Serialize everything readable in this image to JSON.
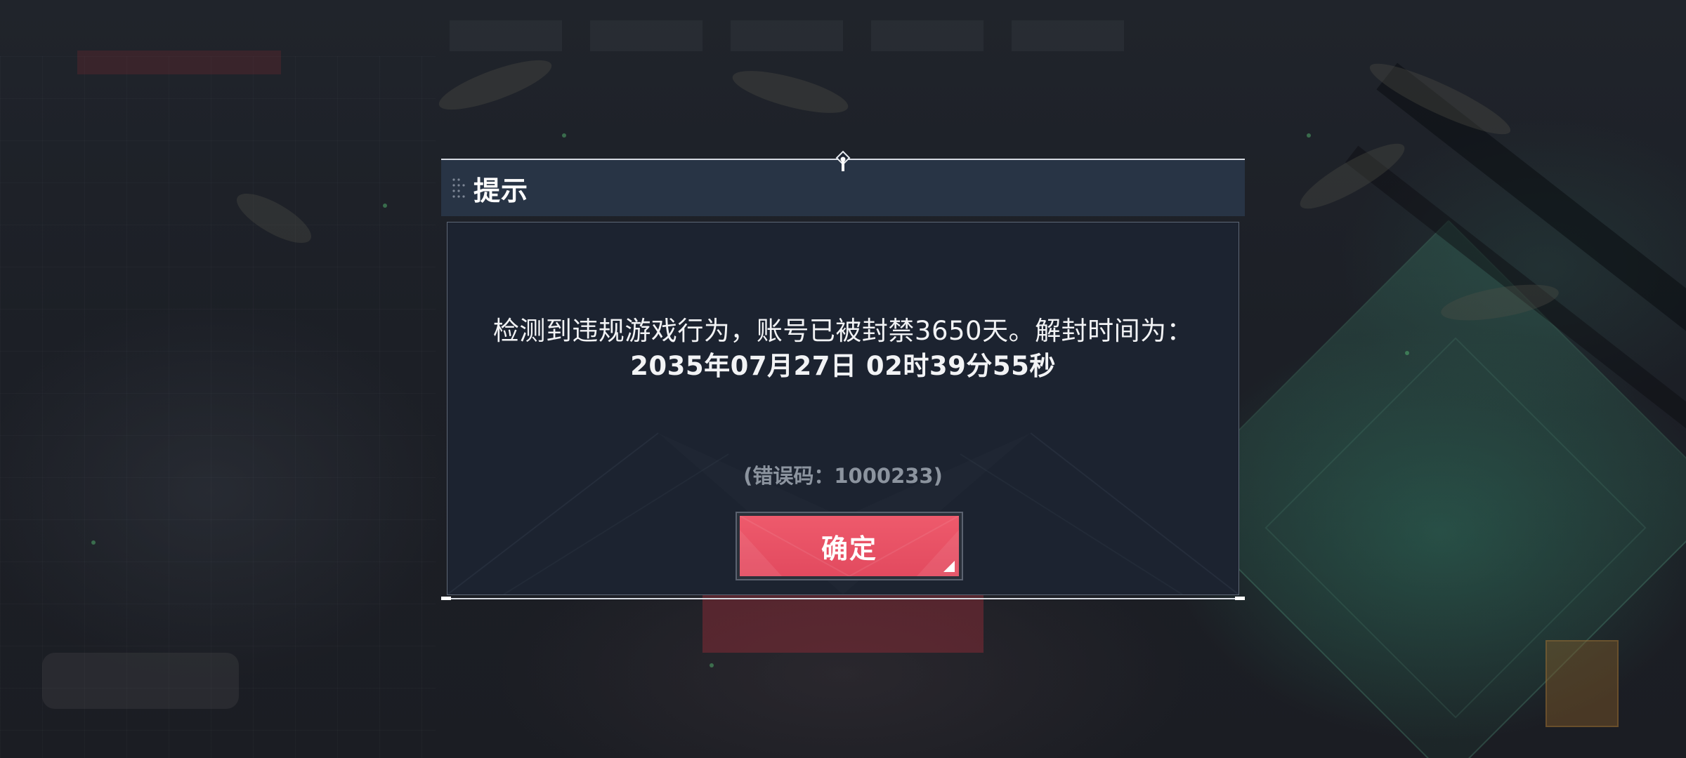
{
  "dialog": {
    "title": "提示",
    "message_line1": "检测到违规游戏行为，账号已被封禁3650天。解封时间为：",
    "message_line2": "2035年07月27日 02时39分55秒",
    "error_code": "(错误码：1000233)",
    "confirm_label": "确定"
  },
  "icons": {
    "grip": "grip-dots-icon",
    "pin": "pin-marker-icon"
  },
  "colors": {
    "header_bg": "#283445",
    "body_bg": "#1c2330",
    "confirm_button": "#e24a5f",
    "message_text": "#f2f3f5",
    "error_code_text": "#8c949f"
  }
}
